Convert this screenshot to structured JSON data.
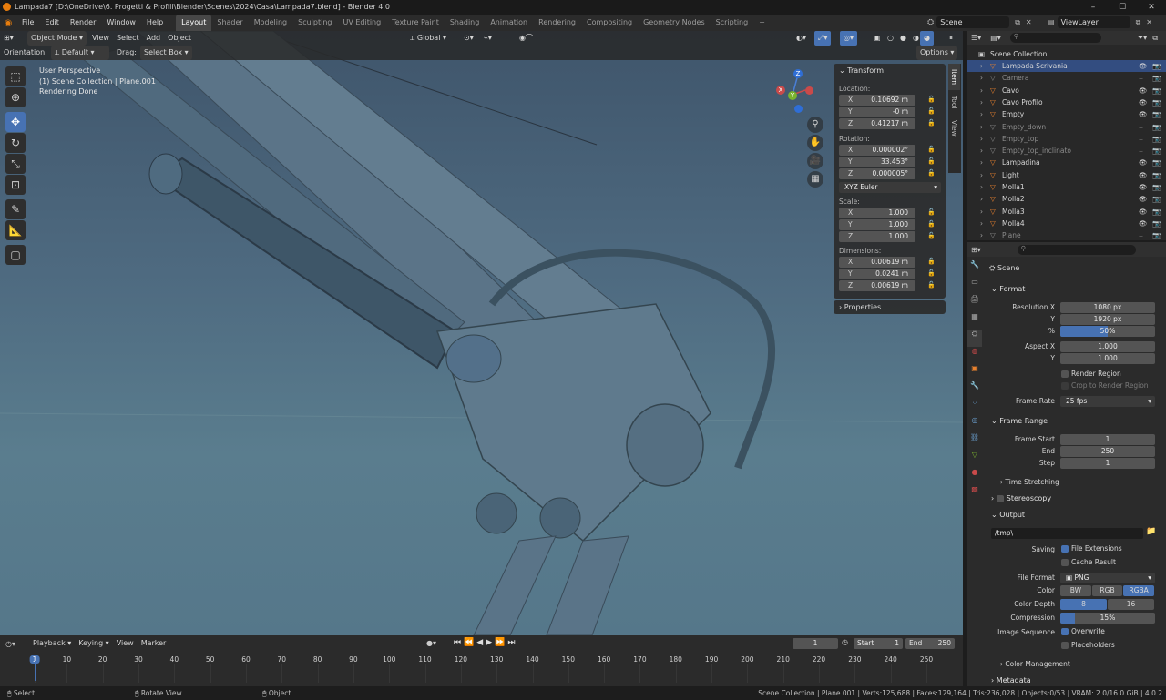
{
  "title": {
    "text": "Lampada7 [D:\\OneDrive\\6. Progetti & Profili\\Blender\\Scenes\\2024\\Casa\\Lampada7.blend] - Blender 4.0",
    "minimize": "–",
    "maximize": "☐",
    "close": "✕"
  },
  "menu": [
    "File",
    "Edit",
    "Render",
    "Window",
    "Help"
  ],
  "workspaces": [
    "Layout",
    "Shader",
    "Modeling",
    "Sculpting",
    "UV Editing",
    "Texture Paint",
    "Shading",
    "Animation",
    "Rendering",
    "Compositing",
    "Geometry Nodes",
    "Scripting"
  ],
  "active_workspace": "Layout",
  "add_workspace": "+",
  "scene": {
    "name": "Scene",
    "viewlayer": "ViewLayer"
  },
  "viewport_header": {
    "mode": "Object Mode",
    "menus": [
      "View",
      "Select",
      "Add",
      "Object"
    ],
    "transform_orientation": "Global",
    "orientation_label": "Orientation:",
    "orientation_value": "Default",
    "drag_label": "Drag:",
    "drag_value": "Select Box",
    "options": "Options"
  },
  "overlay_text": {
    "line1": "User Perspective",
    "line2": "(1) Scene Collection | Plane.001",
    "line3": "Rendering Done"
  },
  "gizmo": {
    "x": "X",
    "y": "Y",
    "z": "Z"
  },
  "npanel": {
    "tabs": [
      "Item",
      "Tool",
      "View"
    ],
    "transform_header": "Transform",
    "location_label": "Location:",
    "location": [
      {
        "axis": "X",
        "value": "0.10692 m"
      },
      {
        "axis": "Y",
        "value": "-0 m"
      },
      {
        "axis": "Z",
        "value": "0.41217 m"
      }
    ],
    "rotation_label": "Rotation:",
    "rotation": [
      {
        "axis": "X",
        "value": "0.000002°"
      },
      {
        "axis": "Y",
        "value": "33.453°"
      },
      {
        "axis": "Z",
        "value": "0.000005°"
      }
    ],
    "rotation_mode": "XYZ Euler",
    "scale_label": "Scale:",
    "scale": [
      {
        "axis": "X",
        "value": "1.000"
      },
      {
        "axis": "Y",
        "value": "1.000"
      },
      {
        "axis": "Z",
        "value": "1.000"
      }
    ],
    "dimensions_label": "Dimensions:",
    "dimensions": [
      {
        "axis": "X",
        "value": "0.00619 m"
      },
      {
        "axis": "Y",
        "value": "0.0241 m"
      },
      {
        "axis": "Z",
        "value": "0.00619 m"
      }
    ],
    "properties_header": "Properties"
  },
  "outliner": {
    "root": "Scene Collection",
    "items": [
      {
        "name": "Lampada Scrivania",
        "dim": false
      },
      {
        "name": "Camera",
        "dim": true
      },
      {
        "name": "Cavo",
        "dim": false
      },
      {
        "name": "Cavo Profilo",
        "dim": false
      },
      {
        "name": "Empty",
        "dim": false
      },
      {
        "name": "Empty_down",
        "dim": true
      },
      {
        "name": "Empty_top",
        "dim": true
      },
      {
        "name": "Empty_top_inclinato",
        "dim": true
      },
      {
        "name": "Lampadina",
        "dim": false
      },
      {
        "name": "Light",
        "dim": false
      },
      {
        "name": "Molla1",
        "dim": false
      },
      {
        "name": "Molla2",
        "dim": false
      },
      {
        "name": "Molla3",
        "dim": false
      },
      {
        "name": "Molla4",
        "dim": false
      },
      {
        "name": "Plane",
        "dim": true
      }
    ]
  },
  "properties": {
    "context": "Scene",
    "format_header": "Format",
    "resolution_x_label": "Resolution X",
    "resolution_x": "1080 px",
    "resolution_y_label": "Y",
    "resolution_y": "1920 px",
    "resolution_pct_label": "%",
    "resolution_pct": "50%",
    "resolution_pct_fraction": 0.5,
    "aspect_x_label": "Aspect X",
    "aspect_x": "1.000",
    "aspect_y_label": "Y",
    "aspect_y": "1.000",
    "render_region": "Render Region",
    "crop_region": "Crop to Render Region",
    "frame_rate_label": "Frame Rate",
    "frame_rate": "25 fps",
    "frame_range_header": "Frame Range",
    "frame_start_label": "Frame Start",
    "frame_start": "1",
    "frame_end_label": "End",
    "frame_end": "250",
    "frame_step_label": "Step",
    "frame_step": "1",
    "time_stretching": "Time Stretching",
    "stereoscopy": "Stereoscopy",
    "output_header": "Output",
    "output_path": "/tmp\\",
    "saving_label": "Saving",
    "file_extensions": "File Extensions",
    "cache_result": "Cache Result",
    "file_format_label": "File Format",
    "file_format": "PNG",
    "color_label": "Color",
    "color_options": [
      "BW",
      "RGB",
      "RGBA"
    ],
    "color_selected": "RGBA",
    "color_depth_label": "Color Depth",
    "color_depth_options": [
      "8",
      "16"
    ],
    "color_depth_selected": "8",
    "compression_label": "Compression",
    "compression": "15%",
    "compression_fraction": 0.15,
    "image_sequence_label": "Image Sequence",
    "overwrite": "Overwrite",
    "placeholders": "Placeholders",
    "color_management": "Color Management",
    "metadata": "Metadata"
  },
  "timeline": {
    "menus": [
      "Playback",
      "Keying",
      "View",
      "Marker"
    ],
    "current_frame": "1",
    "start_label": "Start",
    "start": "1",
    "end_label": "End",
    "end": "250",
    "ticks": [
      "1",
      "10",
      "20",
      "30",
      "40",
      "50",
      "60",
      "70",
      "80",
      "90",
      "100",
      "110",
      "120",
      "130",
      "140",
      "150",
      "160",
      "170",
      "180",
      "190",
      "200",
      "210",
      "220",
      "230",
      "240",
      "250"
    ]
  },
  "statusbar": {
    "select": "Select",
    "rotate": "Rotate View",
    "object": "Object",
    "stats": "Scene Collection | Plane.001 | Verts:125,688 | Faces:129,164 | Tris:236,028 | Objects:0/53 | VRAM: 2.0/16.0 GiB | 4.0.2"
  },
  "colors": {
    "accent": "#4772b3",
    "panel": "#2b2b2b",
    "viewport_top": "#3f556b",
    "viewport_bottom": "#55778a"
  }
}
